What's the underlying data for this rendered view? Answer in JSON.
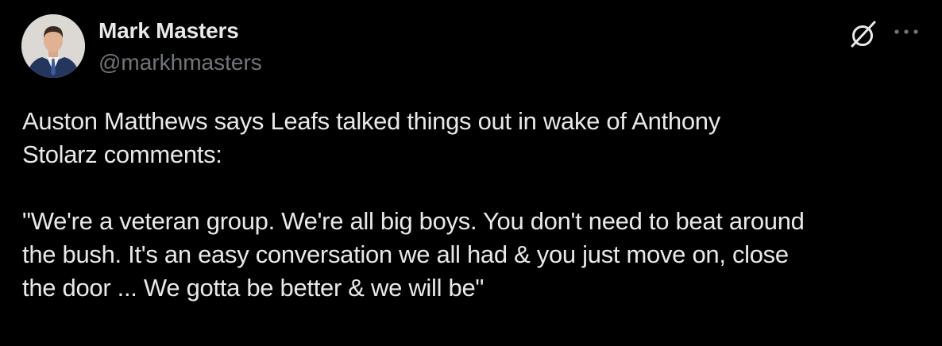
{
  "author": {
    "display_name": "Mark Masters",
    "handle": "@markhmasters",
    "avatar_icon": "user-avatar-photo"
  },
  "header_icons": {
    "grok": "grok-icon",
    "more": "more-options-icon"
  },
  "tweet": {
    "text": "Auston Matthews says Leafs talked things out in wake of Anthony\nStolarz comments:\n\n\"We're a veteran group. We're all big boys. You don't need to beat around\nthe bush. It's an easy conversation we all had & you just move on, close\nthe door ... We gotta be better & we will be\""
  },
  "colors": {
    "background": "#000000",
    "primary_text": "#e7e9ea",
    "secondary_text": "#71767b"
  }
}
